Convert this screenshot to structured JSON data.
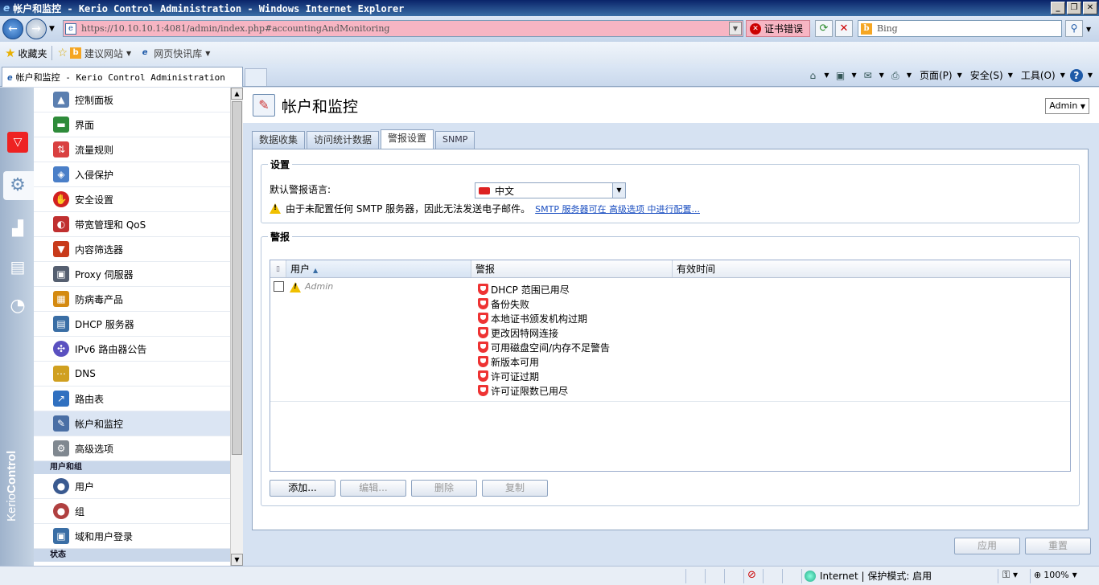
{
  "window": {
    "title": "帐户和监控 - Kerio Control Administration - Windows Internet Explorer",
    "minimize": "_",
    "restore": "❐",
    "close": "✕"
  },
  "addressbar": {
    "url_host": "https://10.10.10.1",
    "url_rest": ":4081/admin/index.php#accountingAndMonitoring",
    "cert_error": "证书错误",
    "search_placeholder": "Bing"
  },
  "favorites": {
    "label": "收藏夹",
    "links": [
      {
        "label": "建议网站"
      },
      {
        "label": "网页快讯库"
      }
    ]
  },
  "browser_tab": {
    "label": "帐户和监控 - Kerio Control Administration"
  },
  "command_bar": {
    "page": "页面(P)",
    "safety": "安全(S)",
    "tools": "工具(O)"
  },
  "rail": {
    "brand_prefix": "Kerio",
    "brand_suffix": "Control"
  },
  "nav": {
    "items": [
      {
        "label": "控制面板",
        "icon": "dashboard-icon",
        "color": "#5b7fb0"
      },
      {
        "label": "界面",
        "icon": "interfaces-icon",
        "color": "#2e8b3a"
      },
      {
        "label": "流量规则",
        "icon": "traffic-rules-icon",
        "color": "#d94040"
      },
      {
        "label": "入侵保护",
        "icon": "intrusion-shield-icon",
        "color": "#4a7fc8"
      },
      {
        "label": "安全设置",
        "icon": "security-hand-icon",
        "color": "#d22020"
      },
      {
        "label": "带宽管理和 QoS",
        "icon": "bandwidth-icon",
        "color": "#c03030"
      },
      {
        "label": "内容筛选器",
        "icon": "content-filter-icon",
        "color": "#c83a1a"
      },
      {
        "label": "Proxy 伺服器",
        "icon": "proxy-icon",
        "color": "#555f70"
      },
      {
        "label": "防病毒产品",
        "icon": "antivirus-icon",
        "color": "#d48a10"
      },
      {
        "label": "DHCP 服务器",
        "icon": "dhcp-icon",
        "color": "#3a6ea5"
      },
      {
        "label": "IPv6 路由器公告",
        "icon": "ipv6-icon",
        "color": "#5a50c0"
      },
      {
        "label": "DNS",
        "icon": "dns-icon",
        "color": "#d0a020"
      },
      {
        "label": "路由表",
        "icon": "routing-icon",
        "color": "#3070c0"
      },
      {
        "label": "帐户和监控",
        "icon": "accounting-icon",
        "color": "#4a6fa5"
      },
      {
        "label": "高级选项",
        "icon": "advanced-gears-icon",
        "color": "#808890"
      }
    ],
    "section_users": "用户和组",
    "user_items": [
      {
        "label": "用户",
        "icon": "user-icon",
        "color": "#3a5a90"
      },
      {
        "label": "组",
        "icon": "group-icon",
        "color": "#b04040"
      },
      {
        "label": "域和用户登录",
        "icon": "domain-login-icon",
        "color": "#3a6ea5"
      }
    ],
    "partial_section": "状态"
  },
  "page": {
    "title": "帐户和监控",
    "user_menu": "Admin",
    "tabs": [
      "数据收集",
      "访问统计数据",
      "警报设置",
      "SNMP"
    ],
    "active_tab": "警报设置"
  },
  "settings": {
    "legend": "设置",
    "lang_label": "默认警报语言:",
    "lang_value": "中文",
    "warning_text": "由于未配置任何 SMTP 服务器，因此无法发送电子邮件。",
    "warning_link": "SMTP 服务器可在 高级选项 中进行配置..."
  },
  "alerts": {
    "legend": "警报",
    "columns": {
      "user": "用户",
      "alert": "警报",
      "valid": "有效时间"
    },
    "rows": [
      {
        "user": "Admin",
        "alerts": [
          "DHCP 范围已用尽",
          "备份失败",
          "本地证书颁发机构过期",
          "更改因特网连接",
          "可用磁盘空间/内存不足警告",
          "新版本可用",
          "许可证过期",
          "许可证限数已用尽"
        ],
        "valid": ""
      }
    ],
    "buttons": {
      "add": "添加...",
      "edit": "编辑...",
      "delete": "删除",
      "copy": "复制"
    }
  },
  "footer": {
    "apply": "应用",
    "reset": "重置"
  },
  "statusbar": {
    "zone": "Internet | 保护模式: 启用",
    "zoom": "100%"
  }
}
